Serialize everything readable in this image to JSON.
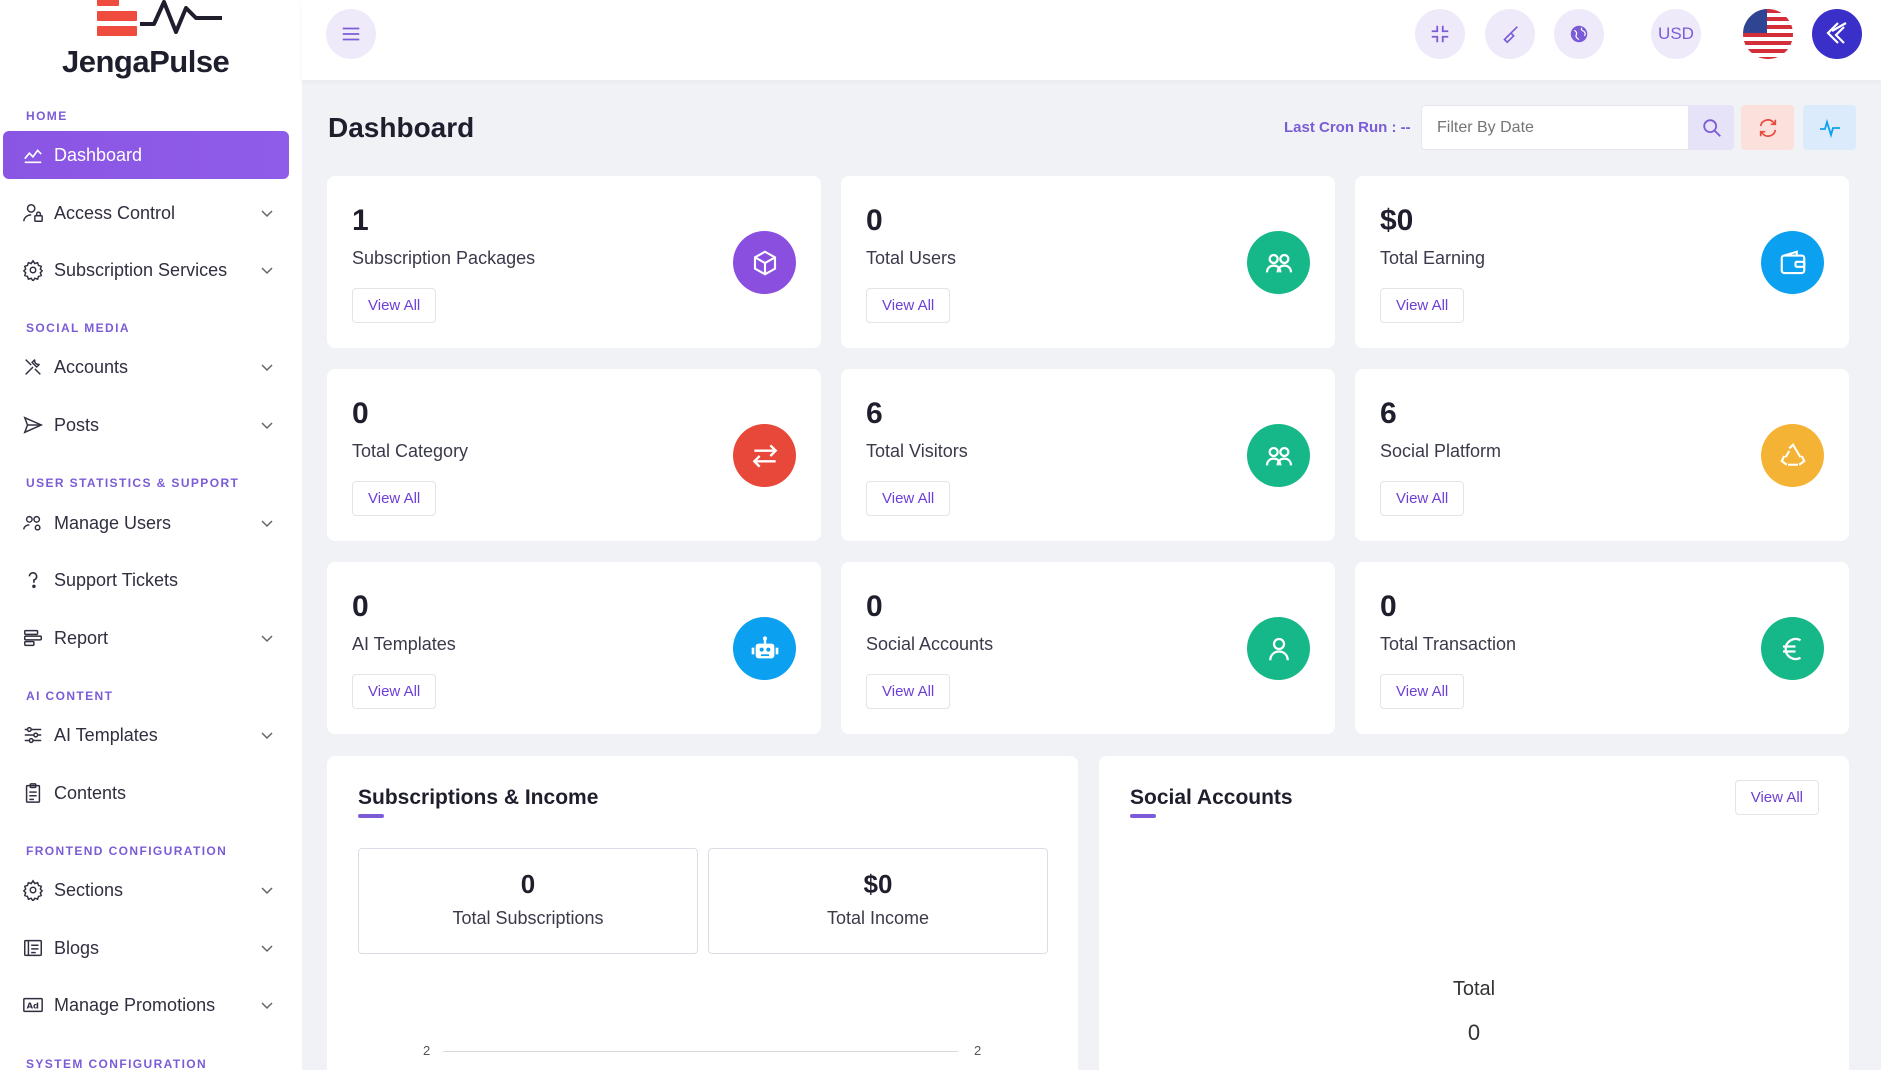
{
  "brand": {
    "name": "JengaPulse"
  },
  "sidebar": {
    "sections": [
      {
        "label": "HOME"
      },
      {
        "label": "SOCIAL MEDIA"
      },
      {
        "label": "USER STATISTICS & SUPPORT"
      },
      {
        "label": "AI CONTENT"
      },
      {
        "label": "FRONTEND CONFIGURATION"
      },
      {
        "label": "SYSTEM CONFIGURATION"
      }
    ],
    "items": [
      {
        "label": "Dashboard",
        "icon": "chart-line-icon",
        "active": true
      },
      {
        "label": "Access Control",
        "icon": "user-lock-icon"
      },
      {
        "label": "Subscription Services",
        "icon": "gear-icon"
      },
      {
        "label": "Accounts",
        "icon": "tools-icon"
      },
      {
        "label": "Posts",
        "icon": "send-icon"
      },
      {
        "label": "Manage Users",
        "icon": "users-gear-icon"
      },
      {
        "label": "Support Tickets",
        "icon": "question-icon"
      },
      {
        "label": "Report",
        "icon": "report-icon"
      },
      {
        "label": "AI Templates",
        "icon": "sliders-icon"
      },
      {
        "label": "Contents",
        "icon": "clipboard-icon"
      },
      {
        "label": "Sections",
        "icon": "gear-icon"
      },
      {
        "label": "Blogs",
        "icon": "newspaper-icon"
      },
      {
        "label": "Manage Promotions",
        "icon": "ad-icon"
      }
    ]
  },
  "topbar": {
    "currency": "USD",
    "colors": {
      "accent": "#7b5cd6",
      "active_nav": "#8a55e3"
    }
  },
  "header": {
    "title": "Dashboard",
    "cron_label": "Last Cron Run : --",
    "filter_placeholder": "Filter By Date"
  },
  "cards": [
    {
      "value": "1",
      "label": "Subscription Packages",
      "action": "View All",
      "icon": "cube-icon",
      "color": "#8b4fe0"
    },
    {
      "value": "0",
      "label": "Total Users",
      "action": "View All",
      "icon": "users-icon",
      "color": "#16b889"
    },
    {
      "value": "$0",
      "label": "Total Earning",
      "action": "View All",
      "icon": "wallet-icon",
      "color": "#0ba0f0"
    },
    {
      "value": "0",
      "label": "Total Category",
      "action": "View All",
      "icon": "arrows-exchange-icon",
      "color": "#e8483a"
    },
    {
      "value": "6",
      "label": "Total Visitors",
      "action": "View All",
      "icon": "users-icon",
      "color": "#16b889"
    },
    {
      "value": "6",
      "label": "Social Platform",
      "action": "View All",
      "icon": "recycle-icon",
      "color": "#f5b335"
    },
    {
      "value": "0",
      "label": "AI Templates",
      "action": "View All",
      "icon": "robot-icon",
      "color": "#0ba0f0"
    },
    {
      "value": "0",
      "label": "Social Accounts",
      "action": "View All",
      "icon": "user-icon",
      "color": "#16b889"
    },
    {
      "value": "0",
      "label": "Total Transaction",
      "action": "View All",
      "icon": "euro-icon",
      "color": "#16b889"
    }
  ],
  "subscriptions_panel": {
    "title": "Subscriptions & Income",
    "boxes": [
      {
        "value": "0",
        "label": "Total Subscriptions"
      },
      {
        "value": "$0",
        "label": "Total Income"
      }
    ],
    "axis_left": "2",
    "axis_right": "2"
  },
  "social_panel": {
    "title": "Social Accounts",
    "action": "View All",
    "total_label": "Total",
    "total_value": "0"
  }
}
